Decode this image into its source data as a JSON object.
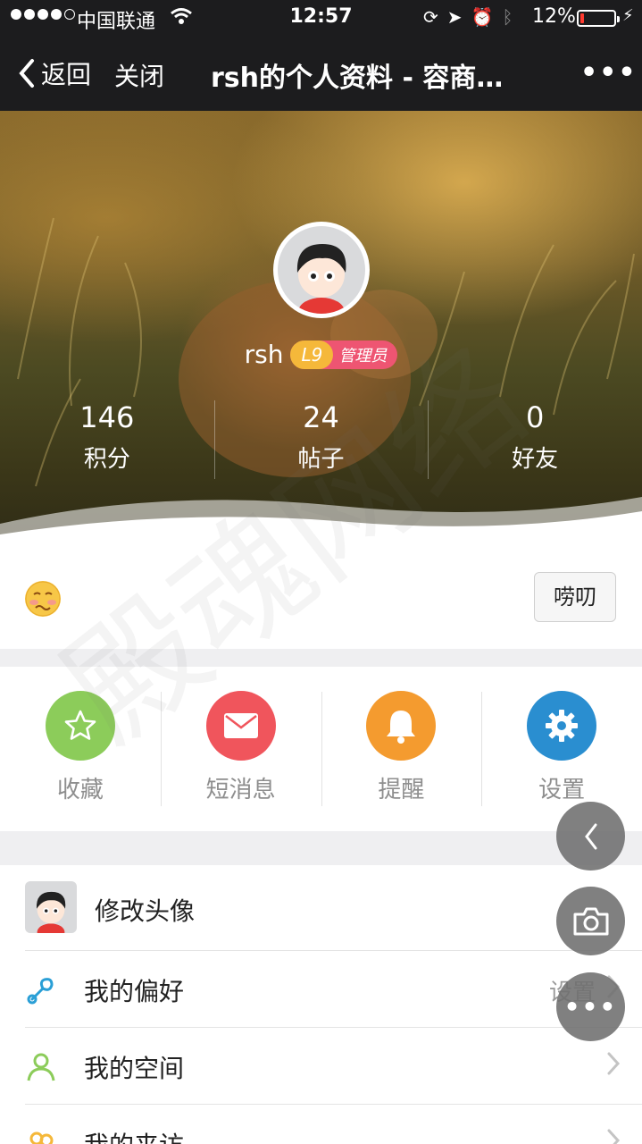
{
  "status_bar": {
    "carrier": "中国联通",
    "time": "12:57",
    "battery_percent": "12%",
    "battery_level": 0.12,
    "battery_color": "#ff3b30",
    "signal_bars_filled": 4,
    "signal_bars_total": 5
  },
  "nav": {
    "back_label": "返回",
    "close_label": "关闭",
    "title": "rsh的个人资料 - 容商…",
    "more_glyph": "•••"
  },
  "profile": {
    "username": "rsh",
    "level": "L9",
    "role": "管理员",
    "stats": [
      {
        "value": "146",
        "label": "积分"
      },
      {
        "value": "24",
        "label": "帖子"
      },
      {
        "value": "0",
        "label": "好友"
      }
    ]
  },
  "signature": {
    "emoji_icon": "confused-face-icon",
    "chat_button": "唠叨"
  },
  "actions": [
    {
      "label": "收藏",
      "icon": "star-icon",
      "color": "#8ccc5a"
    },
    {
      "label": "短消息",
      "icon": "envelope-icon",
      "color": "#f0555c"
    },
    {
      "label": "提醒",
      "icon": "bell-icon",
      "color": "#f49b2f"
    },
    {
      "label": "设置",
      "icon": "gear-icon",
      "color": "#2a8ed0"
    }
  ],
  "menu": [
    {
      "label": "修改头像",
      "value": ""
    },
    {
      "label": "我的偏好",
      "value": "设置"
    },
    {
      "label": "我的空间",
      "value": ""
    },
    {
      "label": "我的来访",
      "value": ""
    }
  ],
  "watermark": "殿魂网络",
  "colors": {
    "nav_bg": "#1c1c1e",
    "section_gap": "#efeff1",
    "badge_level": "#f5b83a",
    "badge_role": "#ee5572"
  }
}
